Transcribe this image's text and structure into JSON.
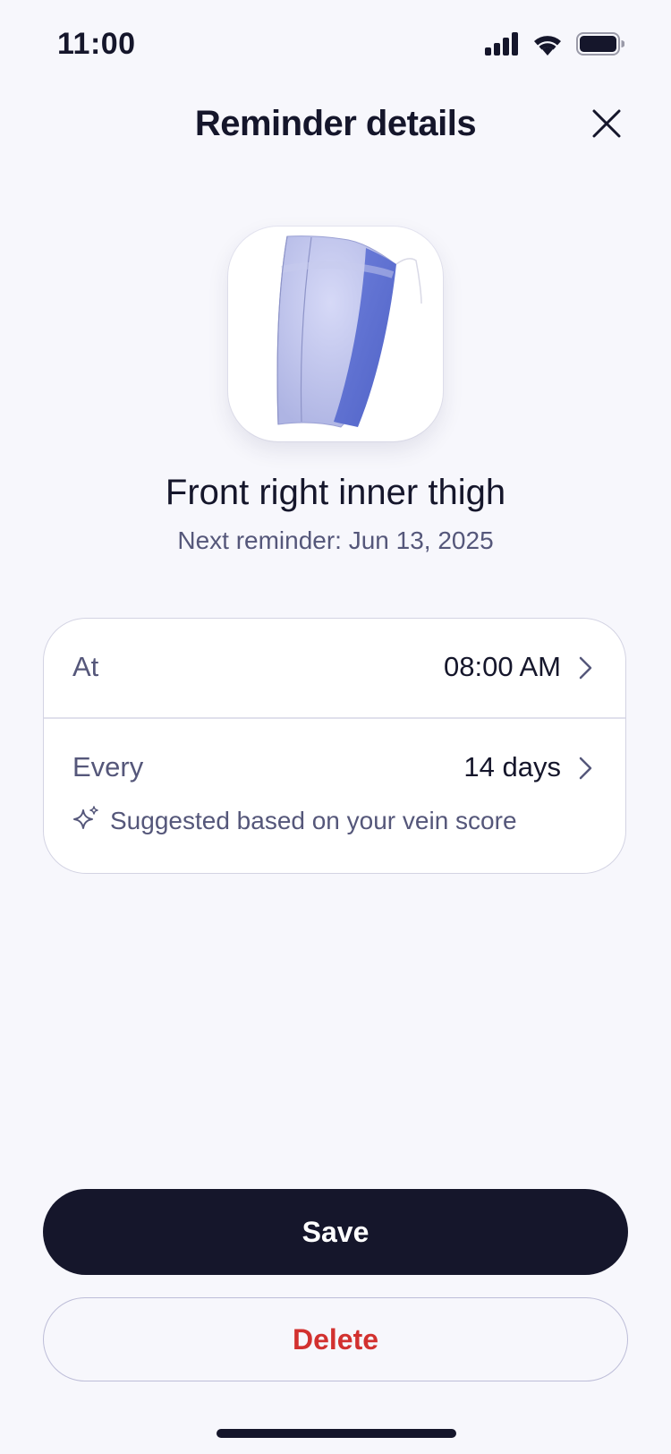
{
  "status_bar": {
    "time": "11:00",
    "icons": [
      "cellular-signal-icon",
      "wifi-icon",
      "battery-icon"
    ]
  },
  "header": {
    "title": "Reminder details",
    "close_icon": "close-icon"
  },
  "region": {
    "name": "Front right inner thigh",
    "next_reminder": "Next reminder: Jun 13, 2025",
    "highlight_color": "#5c6fd0",
    "base_color": "#b6bbe6"
  },
  "settings": {
    "time_row": {
      "label": "At",
      "value": "08:00 AM"
    },
    "interval_row": {
      "label": "Every",
      "value": "14 days",
      "hint_icon": "sparkle-icon",
      "hint": "Suggested based on your vein score"
    }
  },
  "actions": {
    "save_label": "Save",
    "delete_label": "Delete",
    "delete_color": "#d2312f",
    "primary_color": "#15162b"
  }
}
